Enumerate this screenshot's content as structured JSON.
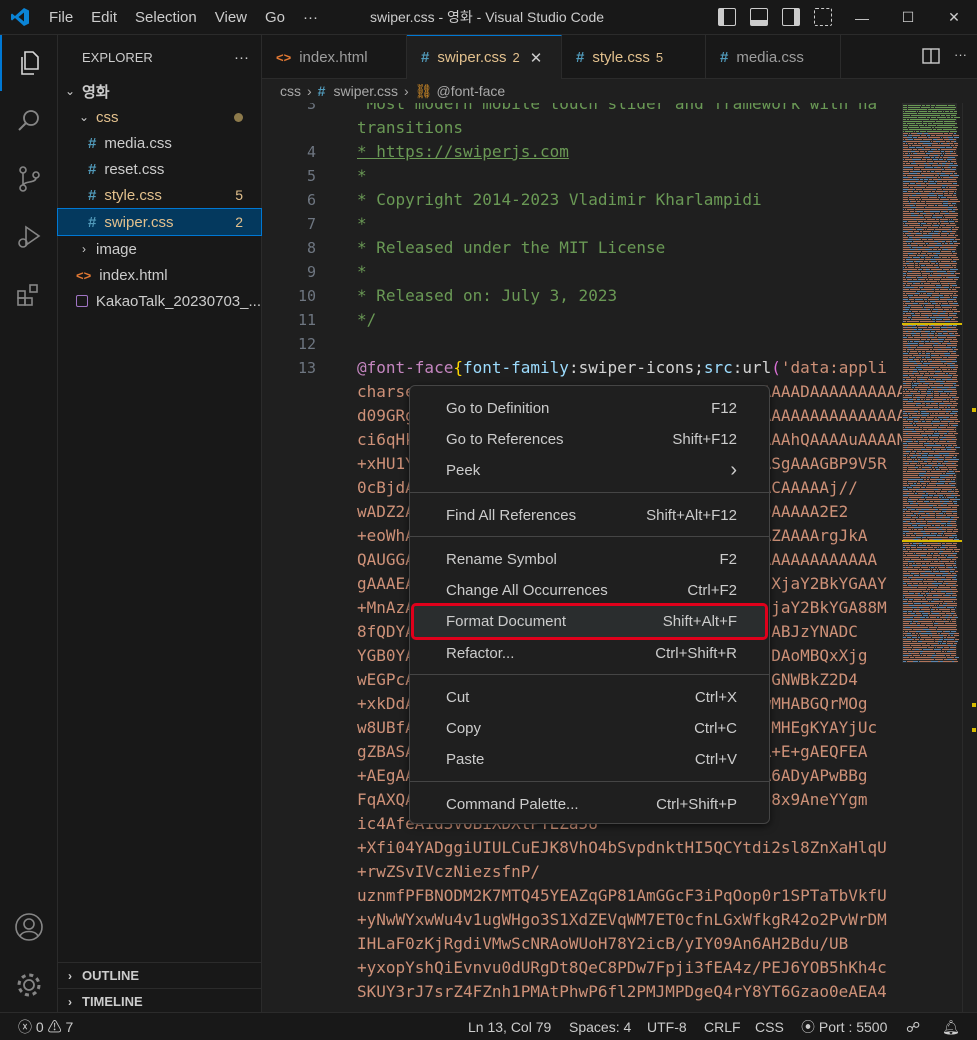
{
  "window": {
    "title": "swiper.css - 영화 - Visual Studio Code",
    "menu": [
      "File",
      "Edit",
      "Selection",
      "View",
      "Go",
      "···"
    ],
    "controls": [
      "—",
      "☐",
      "✕"
    ]
  },
  "explorer": {
    "header": "EXPLORER",
    "more": "···",
    "root": "영화",
    "folder_css": "css",
    "files": [
      {
        "name": "media.css",
        "badge": ""
      },
      {
        "name": "reset.css",
        "badge": ""
      },
      {
        "name": "style.css",
        "badge": "5"
      },
      {
        "name": "swiper.css",
        "badge": "2"
      }
    ],
    "folder_image": "image",
    "index": "index.html",
    "kakao": "KakaoTalk_20230703_...",
    "outline": "OUTLINE",
    "timeline": "TIMELINE"
  },
  "tabs": [
    {
      "label": "index.html",
      "num": ""
    },
    {
      "label": "swiper.css",
      "num": "2"
    },
    {
      "label": "style.css",
      "num": "5"
    },
    {
      "label": "media.css",
      "num": ""
    }
  ],
  "breadcrumb": [
    "css",
    "swiper.css",
    "@font-face"
  ],
  "editor": {
    "line_numbers": [
      "3",
      "",
      "4",
      "5",
      "6",
      "7",
      "8",
      "9",
      "10",
      "11",
      "12",
      "13"
    ],
    "lines": [
      " Most modern mobile touch slider and framework with ha",
      "transitions",
      "* https://swiperjs.com",
      "*",
      "* Copyright 2014-2023 Vladimir Kharlampidi",
      "*",
      "* Released under the MIT License",
      "*",
      "* Released on: July 3, 2023",
      "*/",
      "",
      "@font-face{font-family:swiper-icons;src:url('data:appli"
    ],
    "wrap_lines": [
      "charset=utf-8;base64, d09GRgABAAAAAAZgABAAAAAADAAAAAAAAAAAAA",
      "d09GRgABAAAAAAZgABAAAAAADAAAAAAAAAAAAAAAAAAAAAAAAAAAAAAAAAA",
      "ci6qHkQAAAAAAAAAAAAAAAAAAAAAAAAAAAAAAAAAAAAAAhQAAAAuAAAAN",
      "+xHU1YAAAAAAAAAAAAAAAAAAAAAAAAAAAAAAAAAAAAASgAAAGBP9V5R",
      "0cBjdAAAAAAAAAAAAAAAAAAAAAAAAAAAAAAAAAAACAACAAAAAj//",
      "wADZ2AAAAAAAAAAAAAAAAAAAAAAAAAAAAAAAAAAAAADAAAAA2E2",
      "+eoWhAAAAAAAAAAAAAAAAAAAAAAAAAAAAAAAAAAAAAAZAAAArgJkA",
      "QAUGGAAAAAAAAAAAAAAAAAAAAAAAAAAAAAAAAAAAAAAAAAAAAAAAAA",
      "gAAAEAAAAAAAAAAAAAAAAAAAAAAAAAAAAAAAAAAAAAhXjaY2BkYGAAY",
      "+MnAzAAAAAAAAAAAAAAAAAAAAAAAAAAAAAAAAAAAAA3jaY2BkYGA88M",
      "8fQDYAAAAAAAAAAAAAAAAAAAAAAAAAAAAAAAAAAEMnIABJzYNADC",
      "YGB0YAAAAAAAAAAAAAAAAAAAAAAAAAAAAAAAAAAAawtDAoMBQxXjg",
      "wEGPcAAAAAAAAAAAAAAAAAAAAAAAAAAAAAAAAAACqxgGNWBkZ2D4",
      "+xkDdAAAAAAAAAAAAAAAAAAAAAAAAAAAAAAAAAAA3DwMHABGQrMOg",
      "w8UBfAAAAAAAAAAAAAAAAAAAAAAAAAAAAAAAAAAAAmIMHEgKYAYjUc",
      "gZBASAAAAAAAAAAAAAAAAAAAAAAAAAAAAAAAAAAAAMR+E+gAEQFEA",
      "+AEgAAAAAAAAAAAAAAAAAAAAAAAAAAAAAAAAAAAAN4A6ADyAPwBBg",
      "FqAXQAAAAAAAAAAAAAAAAAAAAAAAAAAAAAAAAAAAW568x9AneYYgm",
      "ic4AfeA1d3VOBiXDXtPYEZa5U",
      "+Xfi04YADggiUIULCuEJK8VhO4bSvpdnktHI5QCYtdi2sl8ZnXaHlqU",
      "+rwZSvIVczNiezsfnP/",
      "uznmfPFBNODM2K7MTQ45YEAZqGP81AmGGcF3iPqOop0r1SPTaTbVkfU",
      "+yNwWYxwWu4v1ugWHgo3S1XdZEVqWM7ET0cfnLGxWfkgR42o2PvWrDM",
      "IHLaF0zKjRgdiVMwScNRAoWUoH78Y2icB/yIY09An6AH2Bdu/UB",
      "+yxopYshQiEvnvu0dURgDt8QeC8PDw7Fpji3fEA4z/PEJ6YOB5hKh4c",
      "SKUY3rJ7srZ4FZnh1PMAtPhwP6fl2PMJMPDgeQ4rY8YT6Gzao0eAEA4"
    ]
  },
  "context_menu": [
    {
      "label": "Go to Definition",
      "shortcut": "F12"
    },
    {
      "label": "Go to References",
      "shortcut": "Shift+F12"
    },
    {
      "label": "Peek",
      "shortcut": "›"
    },
    {
      "label": "Find All References",
      "shortcut": "Shift+Alt+F12"
    },
    {
      "label": "Rename Symbol",
      "shortcut": "F2"
    },
    {
      "label": "Change All Occurrences",
      "shortcut": "Ctrl+F2"
    },
    {
      "label": "Format Document",
      "shortcut": "Shift+Alt+F"
    },
    {
      "label": "Refactor...",
      "shortcut": "Ctrl+Shift+R"
    },
    {
      "label": "Cut",
      "shortcut": "Ctrl+X"
    },
    {
      "label": "Copy",
      "shortcut": "Ctrl+C"
    },
    {
      "label": "Paste",
      "shortcut": "Ctrl+V"
    },
    {
      "label": "Command Palette...",
      "shortcut": "Ctrl+Shift+P"
    }
  ],
  "status": {
    "errors": "0",
    "warnings": "7",
    "position": "Ln 13, Col 79",
    "spaces": "Spaces: 4",
    "encoding": "UTF-8",
    "eol": "CRLF",
    "language": "CSS",
    "port": "Port : 5500"
  },
  "colors": {
    "accent": "#0078d4",
    "highlight_border": "#e0001b",
    "modified": "#e2c08d"
  }
}
